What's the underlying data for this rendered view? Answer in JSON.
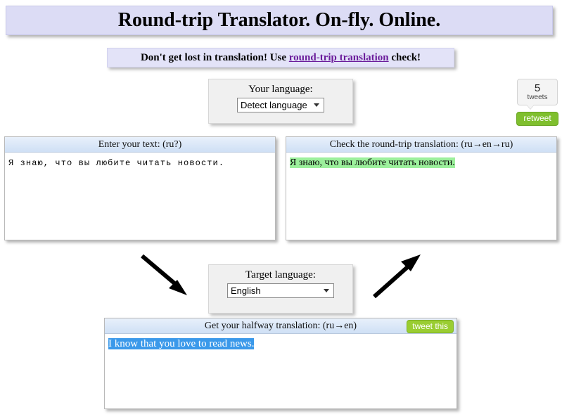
{
  "header": {
    "title": "Round-trip Translator. On-fly. Online.",
    "subtitle_before": "Don't get lost in translation! Use ",
    "subtitle_link": "round-trip translation",
    "subtitle_after": " check!"
  },
  "source_language": {
    "label": "Your language:",
    "selected": "Detect language"
  },
  "target_language": {
    "label": "Target language:",
    "selected": "English"
  },
  "tweet_widget": {
    "count": "5",
    "unit": "tweets",
    "retweet_label": "retweet"
  },
  "panels": {
    "source": {
      "header": "Enter your text: (ru?)",
      "text": "Я знаю, что вы любите читать новости."
    },
    "roundtrip": {
      "header": "Check the round-trip translation: (ru→en→ru)",
      "text": "Я знаю, что вы любите читать новости."
    },
    "halfway": {
      "header": "Get your halfway translation: (ru→en)",
      "tweet_this_label": "tweet this",
      "text": "I know that you love to read news."
    }
  },
  "colors": {
    "banner_background": "#dcdcf5",
    "subtitle_background": "#e3e3f8",
    "link": "#6a1b9a",
    "panel_header_top": "#e8f0fb",
    "panel_header_bottom": "#cfe0f5",
    "roundtrip_highlight": "#9cf09c",
    "halfway_selection": "#3b99ea",
    "retweet_green": "#7fbf2e",
    "tweet_this_green": "#9acd32"
  }
}
